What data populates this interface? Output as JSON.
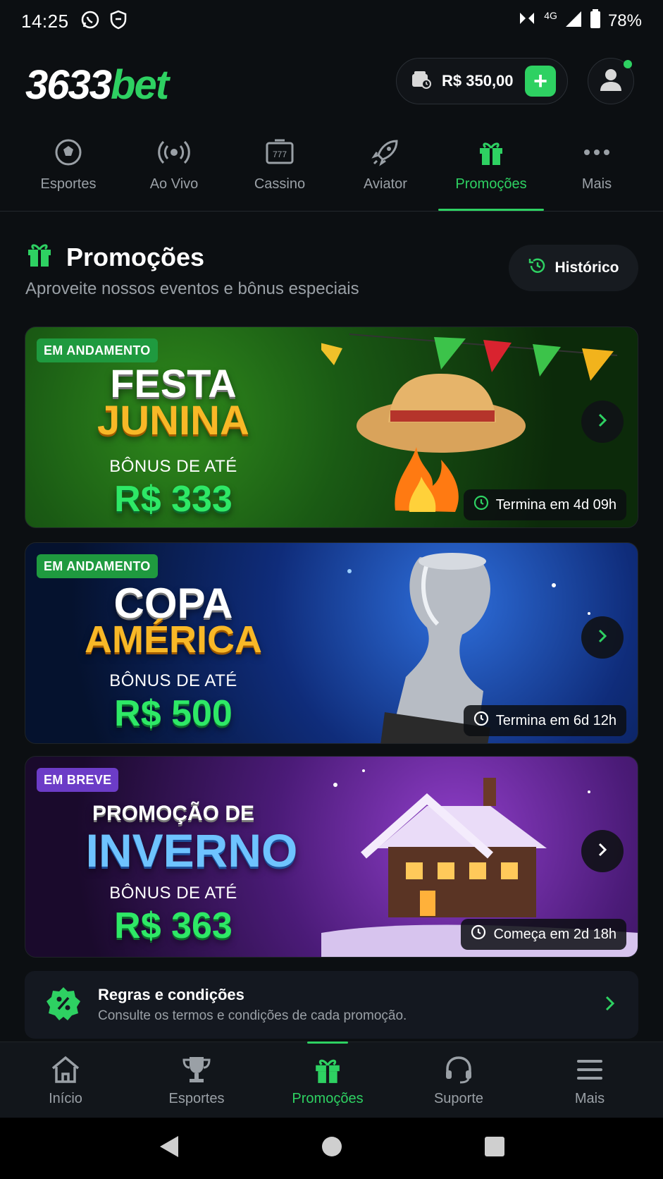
{
  "status_bar": {
    "time": "14:25",
    "network": "4G",
    "battery": "78%"
  },
  "header": {
    "logo_number": "3633",
    "logo_suffix": "bet",
    "balance": "R$ 350,00"
  },
  "top_nav": {
    "tabs": [
      {
        "label": "Esportes",
        "icon": "soccer-ball-icon"
      },
      {
        "label": "Ao Vivo",
        "icon": "live-broadcast-icon"
      },
      {
        "label": "Cassino",
        "icon": "slot-machine-icon"
      },
      {
        "label": "Aviator",
        "icon": "rocket-icon"
      },
      {
        "label": "Promoções",
        "icon": "gift-icon",
        "active": true
      },
      {
        "label": "Mais",
        "icon": "more-dots-icon"
      }
    ]
  },
  "section": {
    "title": "Promoções",
    "subtitle": "Aproveite nossos eventos e bônus especiais",
    "history_label": "Histórico"
  },
  "promotions": [
    {
      "status": "EM ANDAMENTO",
      "title_line1": "FESTA",
      "title_line2": "JUNINA",
      "bonus_label": "BÔNUS DE ATÉ",
      "amount": "R$ 333",
      "timer": "Termina em 4d 09h"
    },
    {
      "status": "EM ANDAMENTO",
      "title_line1": "COPA",
      "title_line2": "AMÉRICA",
      "bonus_label": "BÔNUS DE ATÉ",
      "amount": "R$ 500",
      "timer": "Termina em 6d 12h"
    },
    {
      "status": "EM BREVE",
      "title_line1": "PROMOÇÃO DE",
      "title_line2": "INVERNO",
      "bonus_label": "BÔNUS DE ATÉ",
      "amount": "R$ 363",
      "timer": "Começa em 2d 18h"
    }
  ],
  "rules": {
    "title": "Regras e condições",
    "subtitle": "Consulte os termos e condições de cada promoção."
  },
  "bottom_nav": {
    "items": [
      {
        "label": "Início",
        "icon": "home-icon"
      },
      {
        "label": "Esportes",
        "icon": "trophy-icon"
      },
      {
        "label": "Promoções",
        "icon": "gift-icon",
        "active": true
      },
      {
        "label": "Suporte",
        "icon": "headset-icon"
      },
      {
        "label": "Mais",
        "icon": "menu-icon"
      }
    ]
  },
  "colors": {
    "accent": "#2ed162",
    "background": "#0c0f12",
    "muted": "#9aa0a6"
  }
}
